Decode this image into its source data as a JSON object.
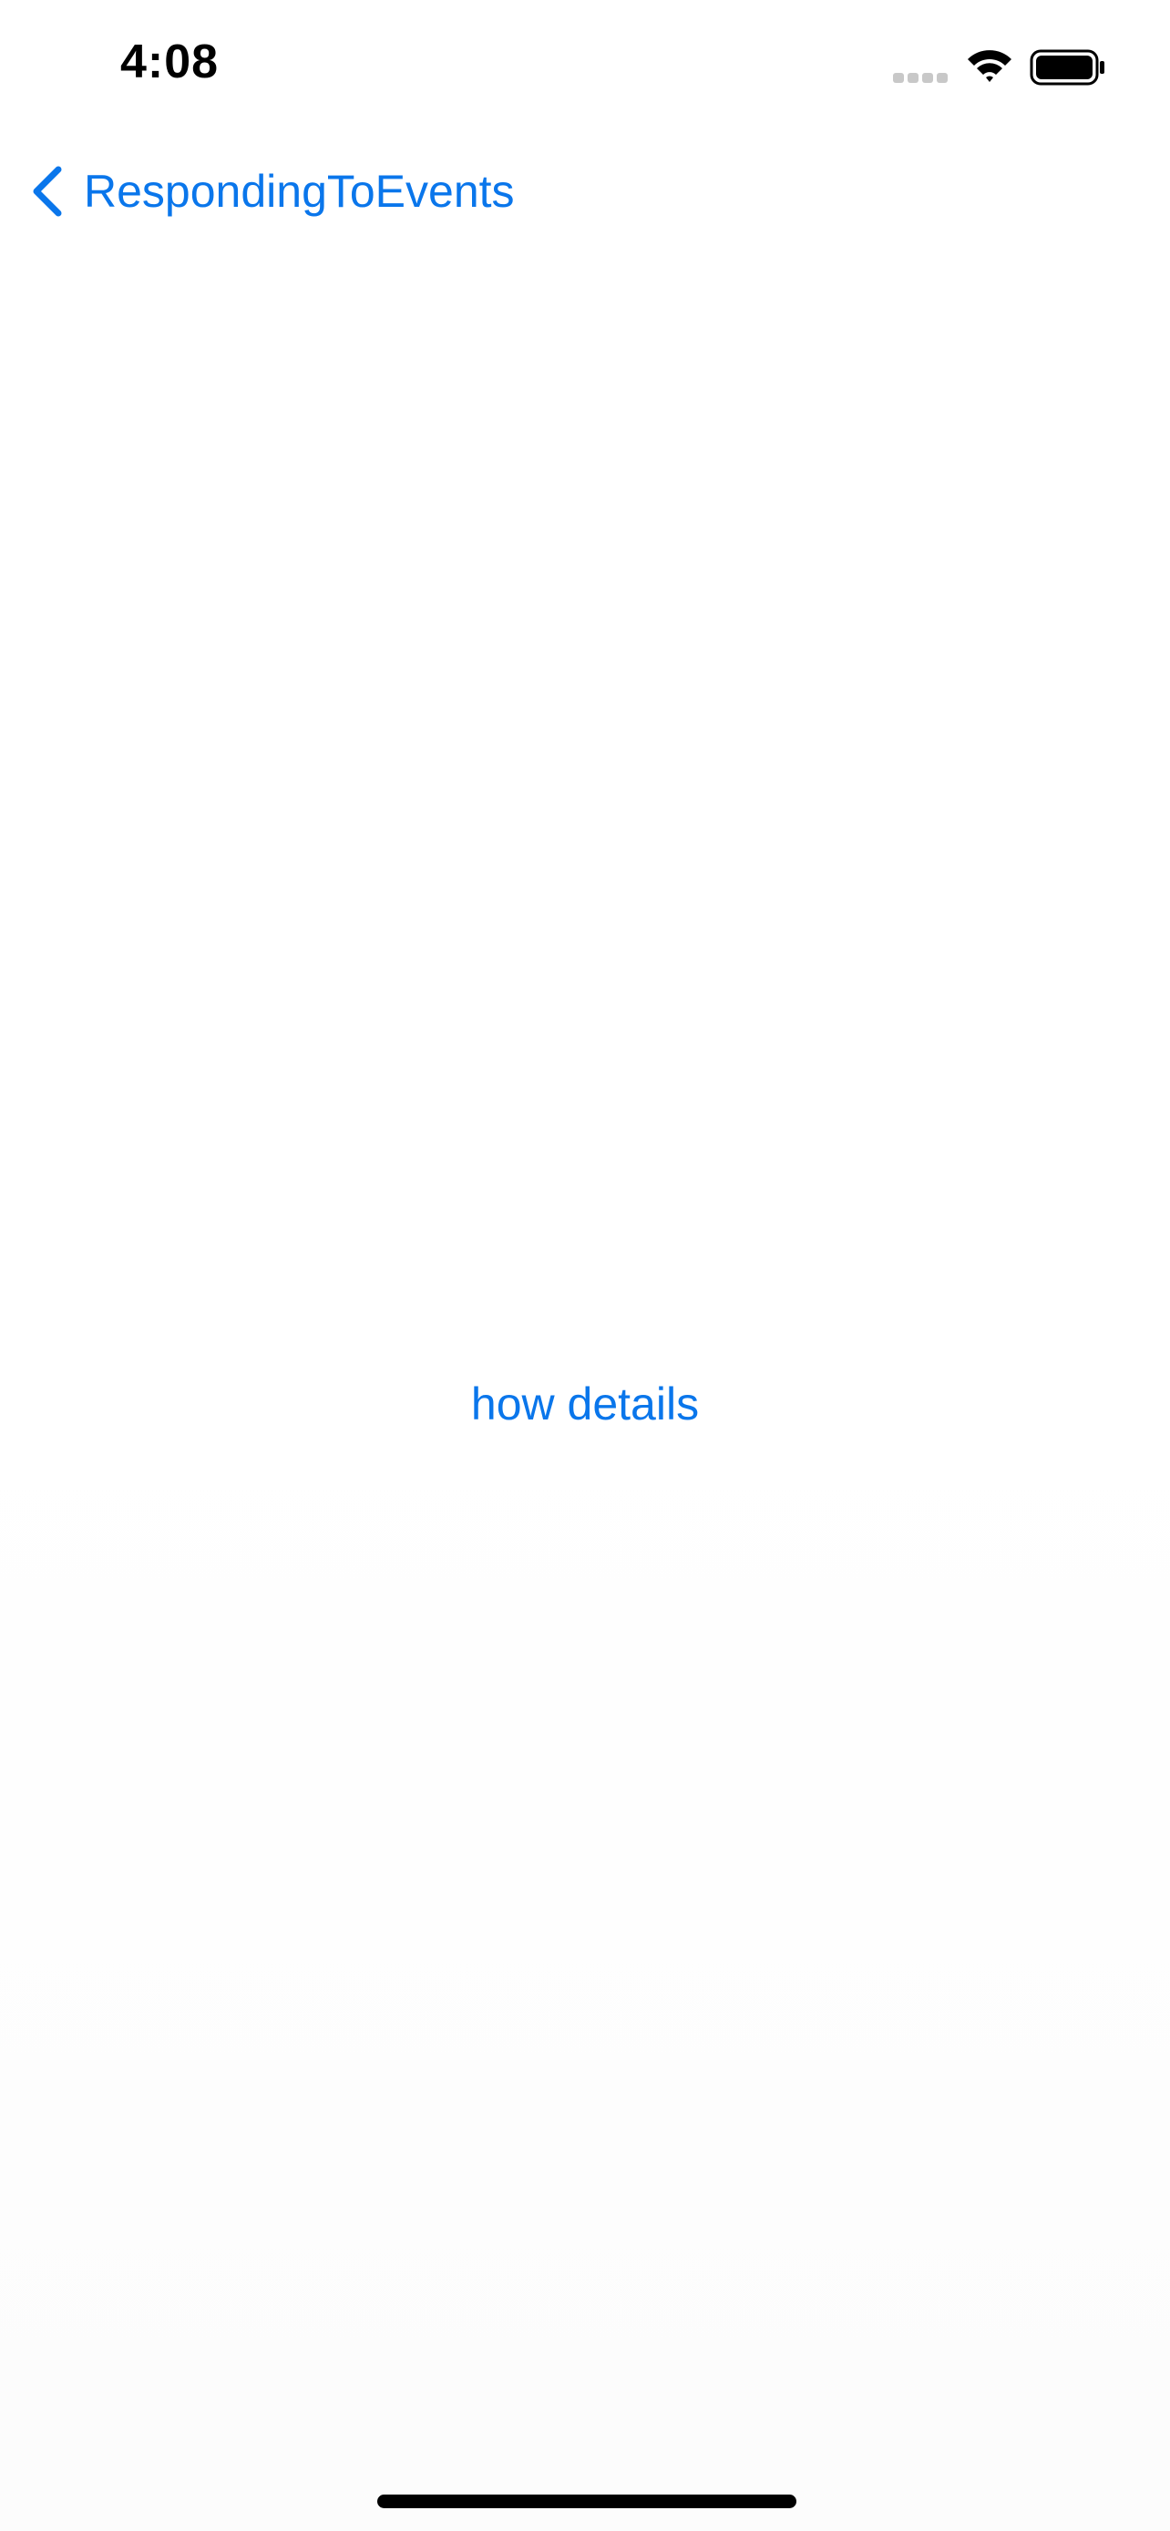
{
  "status_bar": {
    "time": "4:08",
    "signal_icon": "cellular-signal-icon",
    "wifi_icon": "wifi-icon",
    "battery_icon": "battery-icon"
  },
  "nav": {
    "back_icon": "chevron-left-icon",
    "back_label": "RespondingToEvents"
  },
  "main": {
    "action_label": "how details"
  },
  "colors": {
    "accent": "#0a76eb",
    "background": "#ffffff",
    "text": "#000000"
  }
}
